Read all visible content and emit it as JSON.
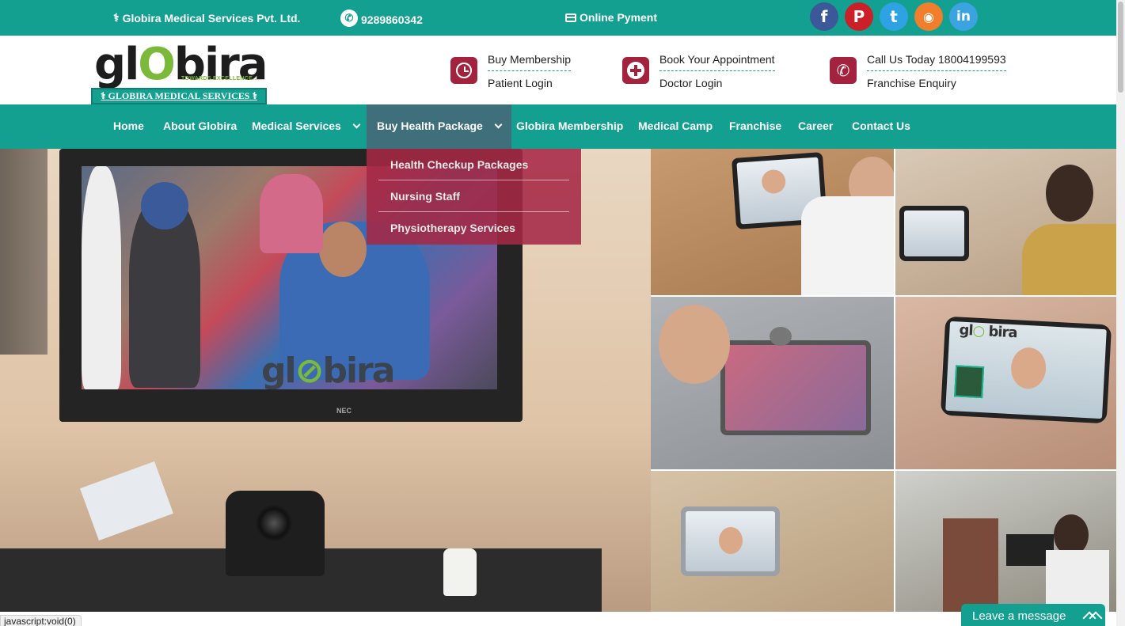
{
  "topbar": {
    "company": "Globira Medical Services Pvt. Ltd.",
    "phone": "9289860342",
    "payment": "Online Pyment",
    "socials": [
      {
        "name": "facebook",
        "glyph": "f",
        "color": "#3b5998"
      },
      {
        "name": "pinterest",
        "glyph": "P",
        "color": "#cb2027"
      },
      {
        "name": "twitter",
        "glyph": "t",
        "color": "#2fa2e3"
      },
      {
        "name": "rss",
        "glyph": "◉",
        "color": "#f07e2a"
      },
      {
        "name": "linkedin",
        "glyph": "in",
        "color": "#3aa3e0"
      }
    ]
  },
  "logo": {
    "word_a": "gl",
    "word_o": "O",
    "word_b": "bira",
    "tagline": "TOWARDS EXCELLENCE...",
    "bar_text": "GLOBIRA MEDICAL SERVICES"
  },
  "header": {
    "blocks": [
      {
        "icon": "clock-icon",
        "line1": "Buy Membership",
        "line2": "Patient Login"
      },
      {
        "icon": "medical-cross-icon",
        "line1": "Book Your Appointment",
        "line2": "Doctor Login"
      },
      {
        "icon": "phone-icon",
        "line1": "Call Us Today 18004199593",
        "line2": "Franchise Enquiry"
      }
    ]
  },
  "nav": {
    "items": [
      {
        "label": "Home"
      },
      {
        "label": "About Globira"
      },
      {
        "label": "Medical Services",
        "has_dropdown": true
      },
      {
        "label": "Buy Health Package",
        "has_dropdown": true,
        "active": true
      },
      {
        "label": "Globira Membership"
      },
      {
        "label": "Medical Camp"
      },
      {
        "label": "Franchise"
      },
      {
        "label": "Career"
      },
      {
        "label": "Contact Us"
      }
    ]
  },
  "dropdown": {
    "items": [
      "Health Checkup Packages",
      "Nursing Staff",
      "Physiotherapy Services"
    ]
  },
  "hero": {
    "tv_brand": "NEC",
    "watermark": "globira",
    "tile_brand": "globira"
  },
  "status_bar": "javascript:void(0)",
  "chat": {
    "label": "Leave a message"
  },
  "colors": {
    "teal": "#13a090",
    "maroon": "#a3233f",
    "nav_active": "#3f6f7a"
  }
}
